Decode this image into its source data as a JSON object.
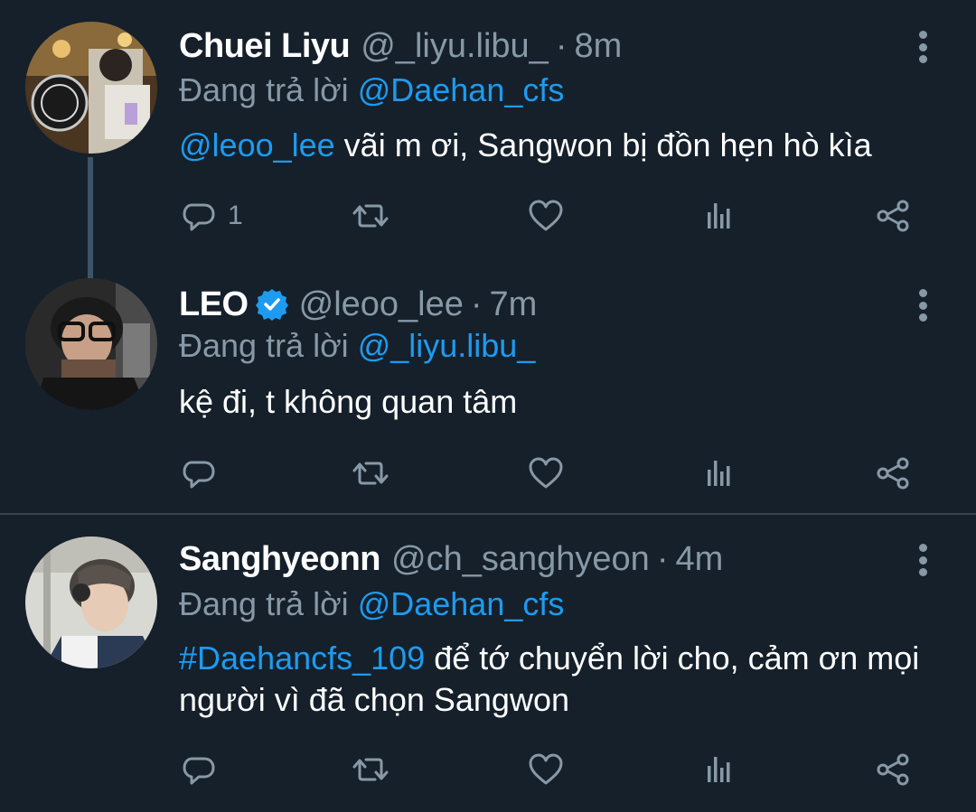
{
  "colors": {
    "background": "#15202b",
    "text": "#ffffff",
    "muted": "#8899a6",
    "accent": "#1d9bf0",
    "divider": "#38444d"
  },
  "replying_prefix": "Đang trả lời",
  "tweets": [
    {
      "name": "Chuei Liyu",
      "handle": "@_liyu.libu_",
      "time": "8m",
      "verified": false,
      "reply_to": "@Daehan_cfs",
      "body_mention": "@leoo_lee",
      "body_text": " vãi m ơi, Sangwon bị đồn hẹn hò kìa",
      "reply_count": "1"
    },
    {
      "name": "LEO",
      "handle": "@leoo_lee",
      "time": "7m",
      "verified": true,
      "reply_to": "@_liyu.libu_",
      "body_mention": "",
      "body_text": "kệ đi, t không quan tâm",
      "reply_count": ""
    },
    {
      "name": "Sanghyeonn",
      "handle": "@ch_sanghyeon",
      "time": "4m",
      "verified": false,
      "reply_to": "@Daehan_cfs",
      "body_mention": "#Daehancfs_109",
      "body_text": " để tớ chuyển lời cho, cảm ơn mọi người vì đã chọn Sangwon",
      "reply_count": ""
    }
  ],
  "icons": [
    "reply-icon",
    "retweet-icon",
    "like-icon",
    "analytics-icon",
    "share-icon",
    "more-options-icon",
    "verified-badge-icon"
  ]
}
